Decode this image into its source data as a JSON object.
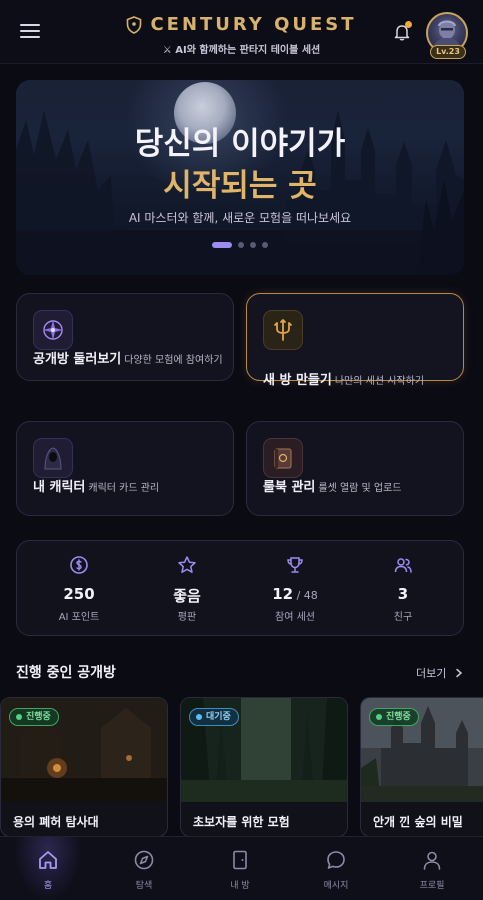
{
  "header": {
    "title": "CENTURY QUEST",
    "subtitle": "⚔ AI와 함께하는 판타지 테이블 세션",
    "level_badge": "Lv.23"
  },
  "hero": {
    "title_line1": "당신의 이야기가",
    "title_line2": "시작되는 곳",
    "subtitle": "AI 마스터와 함께, 새로운 모험을 떠나보세요",
    "slide_count": 4,
    "active_slide": 1
  },
  "actions": [
    {
      "title": "공개방 둘러보기",
      "desc": "다양한 모험에 참여하기",
      "icon": "compass-rune-icon"
    },
    {
      "title": "새 방 만들기",
      "desc": "나만의 세션 시작하기",
      "icon": "trident-icon"
    },
    {
      "title": "내 캐릭터",
      "desc": "캐릭터 카드 관리",
      "icon": "hooded-figure-icon"
    },
    {
      "title": "룰북 관리",
      "desc": "룰셋 열람 및 업로드",
      "icon": "spellbook-icon"
    }
  ],
  "stats": [
    {
      "value": "250",
      "extra": "",
      "label": "AI 포인트",
      "icon": "coin-icon"
    },
    {
      "value": "좋음",
      "extra": "",
      "label": "평판",
      "icon": "star-icon"
    },
    {
      "value": "12",
      "extra": " / 48",
      "label": "참여 세션",
      "icon": "trophy-icon"
    },
    {
      "value": "3",
      "extra": "",
      "label": "친구",
      "icon": "friends-icon"
    }
  ],
  "rooms_section": {
    "title": "진행 중인 공개방",
    "more_label": "더보기"
  },
  "rooms": [
    {
      "name": "용의 폐허 탐사대",
      "status": "진행중"
    },
    {
      "name": "초보자를 위한 모험",
      "status": "대기중"
    },
    {
      "name": "안개 낀 숲의 비밀",
      "status": "진행중"
    }
  ],
  "nav": [
    {
      "label": "홈",
      "icon": "home-icon",
      "active": true
    },
    {
      "label": "탐색",
      "icon": "compass-icon",
      "active": false
    },
    {
      "label": "내 방",
      "icon": "door-icon",
      "active": false
    },
    {
      "label": "메시지",
      "icon": "chat-icon",
      "active": false
    },
    {
      "label": "프로필",
      "icon": "user-icon",
      "active": false
    }
  ],
  "colors": {
    "accent": "#9b8cf2",
    "gold": "#d8b26a",
    "live_green": "#4ed483",
    "waiting_blue": "#5ac0f0"
  }
}
